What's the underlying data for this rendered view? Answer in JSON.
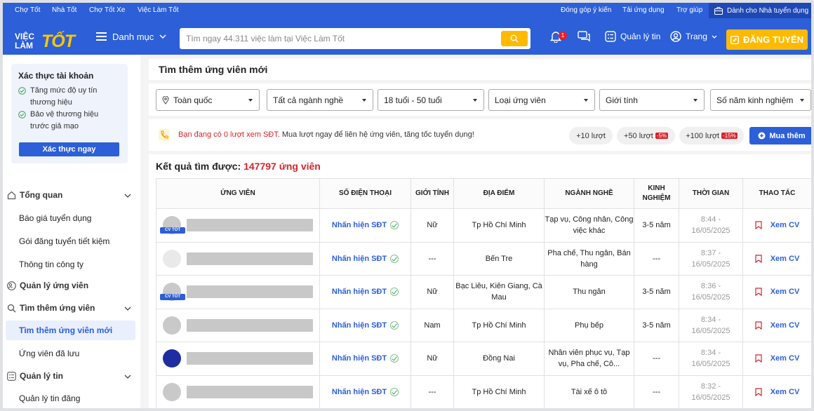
{
  "topbar": {
    "links_left": [
      "Chợ Tốt",
      "Nhà Tốt",
      "Chợ Tốt Xe",
      "Việc Làm Tốt"
    ],
    "links_right": [
      "Đóng góp ý kiến",
      "Tải ứng dụng",
      "Trợ giúp"
    ],
    "employer_label": "Dành cho Nhà tuyển dụng"
  },
  "header": {
    "logo_line1": "VIỆC",
    "logo_line2": "LÀM",
    "logo_big": "TỐT",
    "menu_label": "Danh mục",
    "search_placeholder": "Tìm ngay 44.311 việc làm tại Việc Làm Tốt",
    "notification_count": "1",
    "manage_label": "Quản lý tin",
    "account_label": "Trang",
    "post_button": "ĐĂNG TUYỂN",
    "accent": "#2c5fd8",
    "cta_color": "#ffba00"
  },
  "sidebar": {
    "verify_title": "Xác thực tài khoản",
    "verify_items": [
      "Tăng mức độ uy tín thương hiệu",
      "Bảo vệ thương hiệu trước giả mạo"
    ],
    "verify_button": "Xác thực ngay",
    "nav": {
      "overview": "Tổng quan",
      "pricing": "Báo giá tuyển dụng",
      "saving_packages": "Gói đăng tuyển tiết kiệm",
      "company_info": "Thông tin công ty",
      "manage_candidates": "Quản lý ứng viên",
      "find_candidates": "Tìm thêm ứng viên",
      "find_new": "Tìm thêm ứng viên mới",
      "saved": "Ứng viên đã lưu",
      "manage_posts": "Quản lý tin",
      "manage_posted": "Quản lý tin đăng"
    }
  },
  "page": {
    "title": "Tìm thêm ứng viên mới",
    "filters": [
      "Toàn quốc",
      "Tất cả ngành nghề",
      "18 tuổi - 50 tuổi",
      "Loại ứng viên",
      "Giới tính",
      "Số năm kinh nghiệm"
    ]
  },
  "promo": {
    "text_red": "Bạn đang có 0 lượt xem SĐT.",
    "text_rest": " Mua lượt ngay để liên hệ ứng viên, tăng tốc tuyển dụng!",
    "chips": [
      {
        "label": "+10 lượt",
        "discount": ""
      },
      {
        "label": "+50 lượt",
        "discount": "-5%"
      },
      {
        "label": "+100 lượt",
        "discount": "-15%"
      }
    ],
    "buy_label": "Mua thêm"
  },
  "results": {
    "label": "Kết quả tìm được: ",
    "count_text": "147797 ứng viên",
    "columns": [
      "ỨNG VIÊN",
      "SỐ ĐIỆN THOẠI",
      "GIỚI TÍNH",
      "ĐỊA ĐIỂM",
      "NGÀNH NGHỀ",
      "KINH NGHIỆM",
      "THỜI GIAN",
      "THAO TÁC"
    ],
    "cv_tag": "CV TỐT",
    "phone_label": "Nhấn hiện SĐT",
    "action_label": "Xem CV",
    "rows": [
      {
        "avatar": "gray",
        "cv": true,
        "gender": "Nữ",
        "location": "Tp Hồ Chí Minh",
        "industry": "Tạp vụ, Công nhân, Công việc khác",
        "experience": "3-5 năm",
        "time1": "8:44 -",
        "time2": "16/05/2025"
      },
      {
        "avatar": "light",
        "cv": false,
        "gender": "---",
        "location": "Bến Tre",
        "industry": "Pha chế, Thu ngân, Bán hàng",
        "experience": "---",
        "time1": "8:37 -",
        "time2": "16/05/2025"
      },
      {
        "avatar": "gray",
        "cv": true,
        "gender": "Nữ",
        "location": "Bạc Liêu, Kiên Giang, Cà Mau",
        "industry": "Thu ngân",
        "experience": "3-5 năm",
        "time1": "8:36 -",
        "time2": "16/05/2025"
      },
      {
        "avatar": "gray",
        "cv": false,
        "gender": "Nam",
        "location": "Tp Hồ Chí Minh",
        "industry": "Phụ bếp",
        "experience": "3-5 năm",
        "time1": "8:34 -",
        "time2": "16/05/2025"
      },
      {
        "avatar": "blue",
        "cv": false,
        "gender": "Nữ",
        "location": "Đồng Nai",
        "industry": "Nhân viên phục vụ, Tạp vụ, Pha chế, Cô...",
        "experience": "---",
        "time1": "8:34 -",
        "time2": "16/05/2025"
      },
      {
        "avatar": "gray",
        "cv": false,
        "gender": "---",
        "location": "Tp Hồ Chí Minh",
        "industry": "Tài xế ô tô",
        "experience": "---",
        "time1": "8:32 -",
        "time2": "16/05/2025"
      }
    ]
  }
}
